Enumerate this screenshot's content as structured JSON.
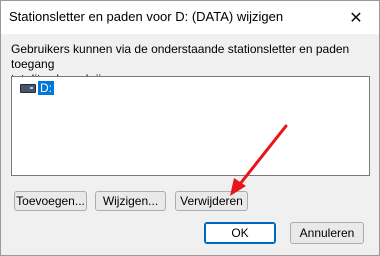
{
  "dialog": {
    "title": "Stationsletter en paden voor D: (DATA) wijzigen",
    "description_line1": "Gebruikers kunnen via de onderstaande stationsletter en paden toegang",
    "description_line2": "tot dit volume krijgen:"
  },
  "list": {
    "items": [
      {
        "label": "D:",
        "icon": "drive-icon",
        "selected": true
      }
    ]
  },
  "buttons": {
    "add": "Toevoegen...",
    "edit": "Wijzigen...",
    "remove": "Verwijderen",
    "ok": "OK",
    "cancel": "Annuleren"
  },
  "annotation": {
    "arrow_color": "#e8141b"
  },
  "colors": {
    "selection": "#0078d7",
    "primary_border": "#0067c0"
  }
}
